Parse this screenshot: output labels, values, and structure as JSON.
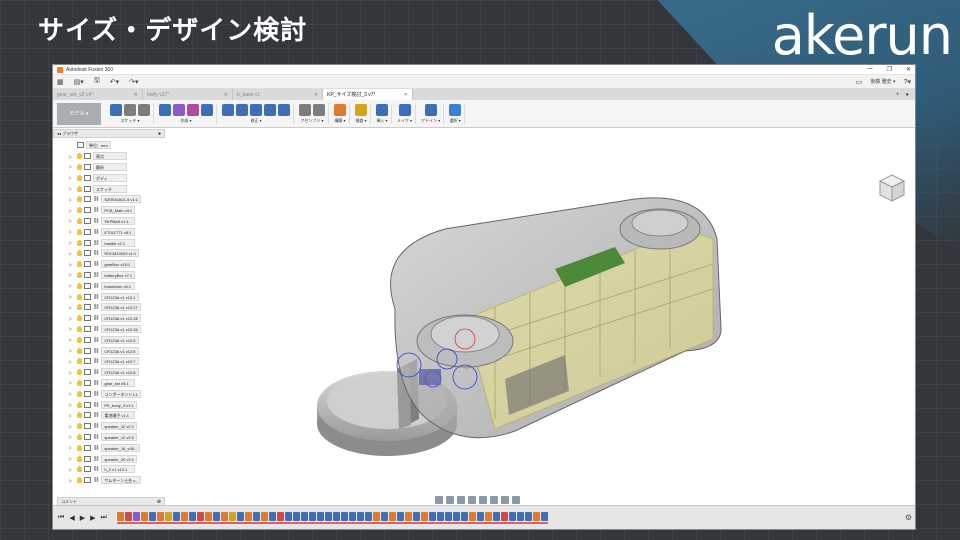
{
  "slide": {
    "title": "サイズ・デザイン検討",
    "brand": "akerun"
  },
  "window": {
    "title": "Autodesk Fusion 360"
  },
  "menubar": {
    "user_name": "後藤 雅史 ▾"
  },
  "tabs": [
    {
      "label": "gear_set_v2 v4*",
      "active": false
    },
    {
      "label": "body v27*",
      "active": false
    },
    {
      "label": "b_base v1",
      "active": false
    },
    {
      "label": "KP_サイズ検討_3 v7*",
      "active": true
    }
  ],
  "toolbar": {
    "workspace_label": "モデル ▾",
    "groups": [
      {
        "label": "スケッチ ▾",
        "icons": [
          "#3d6fb8",
          "#7d7d7d",
          "#7d7d7d"
        ]
      },
      {
        "label": "作成 ▾",
        "icons": [
          "#3d6fb8",
          "#8a5cc7",
          "#b04aa0",
          "#3d6fb8"
        ]
      },
      {
        "label": "修正 ▾",
        "icons": [
          "#3d6fb8",
          "#3d6fb8",
          "#3d6fb8",
          "#3d6fb8",
          "#3d6fb8"
        ]
      },
      {
        "label": "アセンブリ ▾",
        "icons": [
          "#7d7d7d",
          "#7d7d7d"
        ]
      },
      {
        "label": "構築 ▾",
        "icons": [
          "#e07a2a"
        ]
      },
      {
        "label": "検査 ▾",
        "icons": [
          "#d4a51a"
        ]
      },
      {
        "label": "挿入 ▾",
        "icons": [
          "#3d6fb8"
        ]
      },
      {
        "label": "メイク ▾",
        "icons": [
          "#3d6fb8"
        ]
      },
      {
        "label": "アドイン ▾",
        "icons": [
          "#3d6fb8"
        ]
      },
      {
        "label": "選択 ▾",
        "icons": [
          "#3d7fd1"
        ]
      }
    ]
  },
  "browser": {
    "header": "ブラウザ",
    "root": "単位：mm",
    "folders": [
      {
        "label": "原点"
      },
      {
        "label": "解析"
      },
      {
        "label": "ボディ"
      },
      {
        "label": "スケッチ"
      }
    ],
    "components": [
      {
        "label": "S20E45A01-5 v1:1"
      },
      {
        "label": "PCB_Main v4:1"
      },
      {
        "label": "SKPBAA v1:1"
      },
      {
        "label": "ET011T71 v5:1"
      },
      {
        "label": "handle v2:1"
      },
      {
        "label": "RDCM10003 v1:1"
      },
      {
        "label": "gearBox v15:1"
      },
      {
        "label": "batteryBox v7:1"
      },
      {
        "label": "thumbturn v6:1"
      },
      {
        "label": "CR123A v1 v12:1"
      },
      {
        "label": "CR123A v1 v12:27"
      },
      {
        "label": "CR123A v1 v12:28"
      },
      {
        "label": "CR123A v1 v12:26"
      },
      {
        "label": "CR123A v1 v12:5"
      },
      {
        "label": "CR123A v1 v12:6"
      },
      {
        "label": "CR123A v1 v12:7"
      },
      {
        "label": "CR123A v1 v12:8"
      },
      {
        "label": "gear_set v5:1"
      },
      {
        "label": "コンポーネント1:1"
      },
      {
        "label": "PK_body_3 v1:1"
      },
      {
        "label": "電池端子 v1:1"
      },
      {
        "label": "speaker_12 v2:1"
      },
      {
        "label": "speaker_12 v2:2"
      },
      {
        "label": "speaker_16_v06..."
      },
      {
        "label": "speaker_20 v2:1"
      },
      {
        "label": "h_2 v1 v12:1"
      },
      {
        "label": "サムターン土台 v..."
      }
    ]
  },
  "comments_label": "コメント",
  "timeline": {
    "features": [
      "#e07a2a",
      "#d04a4a",
      "#8a5cc7",
      "#e07a2a",
      "#3d6fb8",
      "#e07a2a",
      "#d4a51a",
      "#3d6fb8",
      "#e07a2a",
      "#3d6fb8",
      "#d04a4a",
      "#e07a2a",
      "#3d6fb8",
      "#e07a2a",
      "#d4a51a",
      "#3d6fb8",
      "#e07a2a",
      "#3d6fb8",
      "#e07a2a",
      "#3d6fb8",
      "#d04a4a",
      "#3d6fb8",
      "#3d6fb8",
      "#3d6fb8",
      "#3d6fb8",
      "#3d6fb8",
      "#3d6fb8",
      "#3d6fb8",
      "#3d6fb8",
      "#3d6fb8",
      "#3d6fb8",
      "#3d6fb8",
      "#e07a2a",
      "#3d6fb8",
      "#e07a2a",
      "#3d6fb8",
      "#e07a2a",
      "#3d6fb8",
      "#e07a2a",
      "#3d6fb8",
      "#3d6fb8",
      "#3d6fb8",
      "#3d6fb8",
      "#3d6fb8",
      "#e07a2a",
      "#3d6fb8",
      "#e07a2a",
      "#3d6fb8",
      "#d04a4a",
      "#3d6fb8",
      "#3d6fb8",
      "#3d6fb8",
      "#e07a2a",
      "#3d6fb8"
    ]
  }
}
